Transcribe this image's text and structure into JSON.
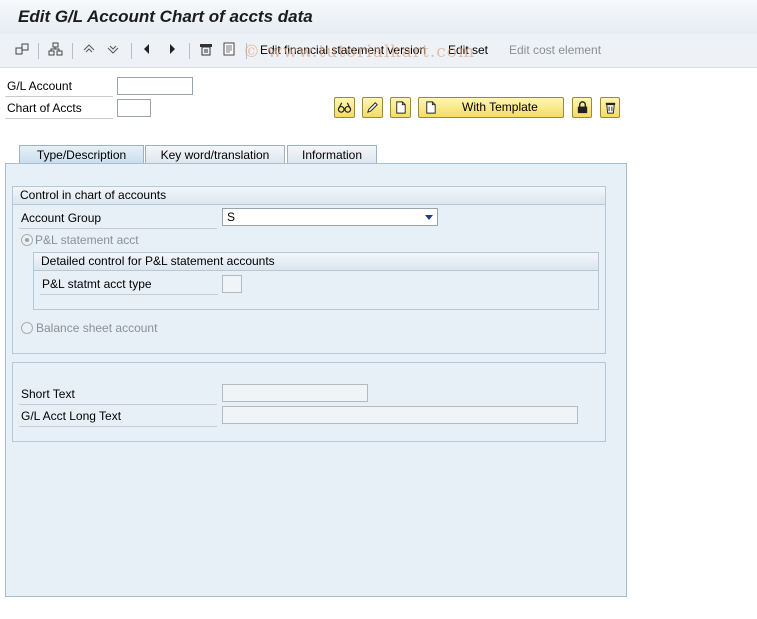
{
  "window": {
    "title": "Edit G/L Account Chart of accts data",
    "watermark": "© www.tutorialkart.com"
  },
  "toolbar": {
    "icons": [
      "switch-icon",
      "hierarchy-icon",
      "undo-icon",
      "redo-icon",
      "previous-icon",
      "next-icon",
      "print-icon",
      "document-icon"
    ],
    "edit_fs_version": "Edit financial statement version",
    "edit_set": "Edit set",
    "edit_cost_element": "Edit cost element"
  },
  "header": {
    "gl_account_label": "G/L Account",
    "gl_account_value": "",
    "chart_of_accts_label": "Chart of Accts",
    "chart_of_accts_value": "",
    "with_template_label": "With Template",
    "buttons": [
      "display-glasses-icon",
      "pencil-icon",
      "new-document-icon",
      "with-template-button",
      "lock-icon",
      "delete-icon"
    ]
  },
  "tabs": [
    {
      "label": "Type/Description",
      "active": true
    },
    {
      "label": "Key word/translation",
      "active": false
    },
    {
      "label": "Information",
      "active": false
    }
  ],
  "control": {
    "title": "Control in chart of accounts",
    "account_group_label": "Account Group",
    "account_group_value": "S",
    "pl_radio_label": "P&L statement acct",
    "pl_selected": true,
    "detailed_title": "Detailed control for P&L statement accounts",
    "pl_type_label": "P&L statmt acct type",
    "pl_type_value": "",
    "bs_radio_label": "Balance sheet account"
  },
  "description": {
    "short_text_label": "Short Text",
    "short_text_value": "",
    "long_text_label": "G/L Acct Long Text",
    "long_text_value": ""
  }
}
